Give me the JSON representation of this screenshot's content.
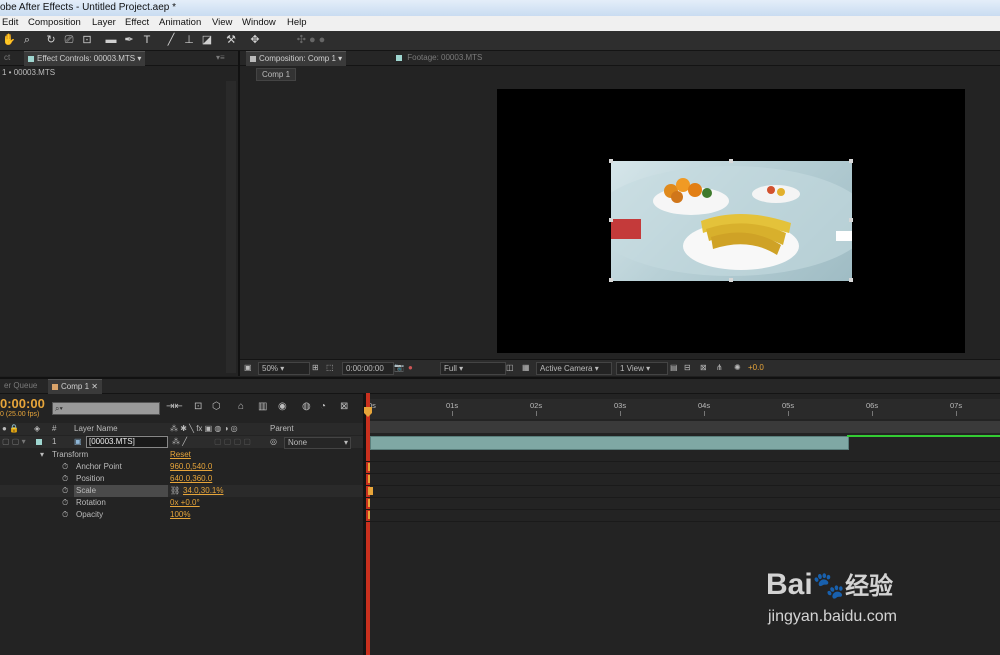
{
  "titlebar": {
    "title": "obe After Effects - Untitled Project.aep *"
  },
  "menus": [
    "Edit",
    "Composition",
    "Layer",
    "Effect",
    "Animation",
    "View",
    "Window",
    "Help"
  ],
  "tools": [
    "hand-icon",
    "zoom-icon",
    "rotate-icon",
    "camera-orbit-icon",
    "pan-behind-icon",
    "rectangle-icon",
    "pen-icon",
    "type-icon",
    "brush-icon",
    "clone-stamp-icon",
    "eraser-icon",
    "roto-brush-icon",
    "puppet-pin-icon"
  ],
  "left_panel": {
    "tab_left": "ct",
    "tab_effect": "Effect Controls: 00003.MTS",
    "breadcrumb": "1 • 00003.MTS"
  },
  "comp_panel": {
    "tab_comp": "Composition: Comp 1",
    "tab_footage": "Footage: 00003.MTS",
    "comp_button": "Comp 1"
  },
  "comp_footer": {
    "zoom": "50%",
    "timecode": "0:00:00:00",
    "resolution": "Full",
    "camera": "Active Camera",
    "view": "1 View",
    "exposure": "+0.0"
  },
  "timeline": {
    "tab_queue": "er Queue",
    "tab_comp": "Comp 1",
    "timecode": "0:00:00",
    "fps": "0 (25.00 fps)",
    "search_placeholder": "",
    "col_num": "#",
    "col_layer": "Layer Name",
    "col_parent": "Parent",
    "layer": {
      "num": "1",
      "name": "[00003.MTS]",
      "parent": "None"
    },
    "transform_label": "Transform",
    "transform_reset": "Reset",
    "properties": [
      {
        "name": "Anchor Point",
        "value": "960.0,540.0"
      },
      {
        "name": "Position",
        "value": "640.0,360.0"
      },
      {
        "name": "Scale",
        "value": "34.0,30.1%"
      },
      {
        "name": "Rotation",
        "value": "0x +0.0°"
      },
      {
        "name": "Opacity",
        "value": "100%"
      }
    ],
    "ruler": [
      "0s",
      "01s",
      "02s",
      "03s",
      "04s",
      "05s",
      "06s",
      "07s"
    ]
  },
  "watermark": {
    "brand": "Bai",
    "brand2": "经验",
    "url": "jingyan.baidu.com"
  }
}
